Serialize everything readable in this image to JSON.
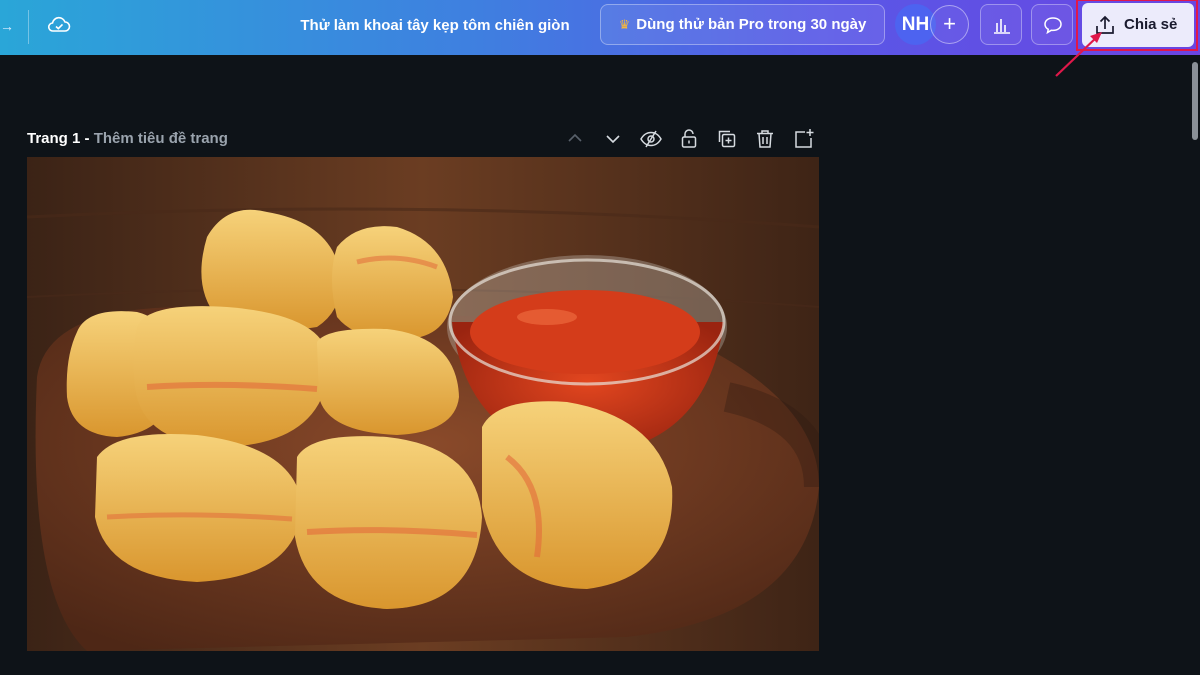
{
  "header": {
    "title": "Thử làm khoai tây kẹp tôm chiên giòn",
    "pro_trial_label": "Dùng thử bản Pro trong 30 ngày",
    "avatar_initials": "NH",
    "share_label": "Chia sẻ",
    "brand_gradient": [
      "#2aa6d8",
      "#6a45e2"
    ],
    "highlight_color": "#e0184a"
  },
  "page": {
    "number_label": "Trang 1",
    "separator": " - ",
    "title_placeholder": "Thêm tiêu đề trang",
    "tools": [
      "chevron-up-icon",
      "chevron-down-icon",
      "hide-icon",
      "lock-icon",
      "duplicate-icon",
      "trash-icon",
      "add-page-icon"
    ]
  },
  "canvas": {
    "image_subject": "fried-potato-shrimp-snacks-with-chili-sauce"
  }
}
